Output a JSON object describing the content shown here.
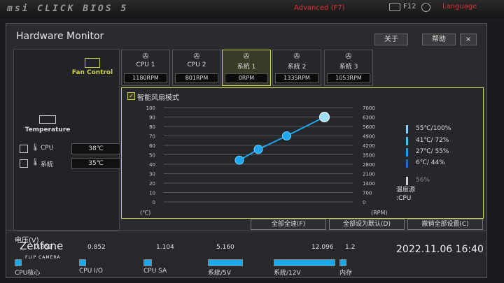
{
  "topbar": {
    "brand": "msi CLICK BIOS 5",
    "advanced": "Advanced (F7)",
    "f12": "F12",
    "language": "Language"
  },
  "window": {
    "title": "Hardware Monitor",
    "about": "关于",
    "help": "帮助",
    "close": "×"
  },
  "sidebar": {
    "fan_control": "Fan Control",
    "temperature": "Temperature",
    "sensors": [
      {
        "name": "CPU",
        "value": "38℃"
      },
      {
        "name": "系統",
        "value": "35℃"
      }
    ]
  },
  "fans": [
    {
      "name": "CPU 1",
      "rpm": "1180RPM",
      "active": false
    },
    {
      "name": "CPU 2",
      "rpm": "801RPM",
      "active": false
    },
    {
      "name": "系統 1",
      "rpm": "0RPM",
      "active": true
    },
    {
      "name": "系統 2",
      "rpm": "1335RPM",
      "active": false
    },
    {
      "name": "系統 3",
      "rpm": "1053RPM",
      "active": false
    }
  ],
  "smart_fan": {
    "label": "智能风扇模式"
  },
  "chart_data": {
    "type": "line",
    "x": [
      40,
      50,
      65,
      85
    ],
    "series": [
      {
        "values": [
          3100,
          3900,
          4900,
          6300
        ]
      }
    ],
    "xlabel": "(℃)",
    "ylabel": "(RPM)",
    "y_left_ticks": [
      "100",
      "90",
      "80",
      "70",
      "60",
      "50",
      "40",
      "30",
      "20",
      "10",
      "0"
    ],
    "y_right_ticks": [
      "7000",
      "6300",
      "5600",
      "4900",
      "4200",
      "3500",
      "2800",
      "2100",
      "1400",
      "700",
      "0"
    ],
    "grid": true
  },
  "legend": [
    {
      "text": "55℃/100%",
      "color": "#7fd3ff"
    },
    {
      "text": "41℃/ 72%",
      "color": "#47bdf5"
    },
    {
      "text": "27℃/ 55%",
      "color": "#1e9de0"
    },
    {
      "text": " 6℃/ 44%",
      "color": "#1673c4"
    },
    {
      "text": "56%",
      "color": "#cfcfcf"
    }
  ],
  "source": {
    "line1": "温度源",
    "line2": ":CPU"
  },
  "buttons": {
    "all_full": "全部全速(F)",
    "all_default": "全部设为默认(D)",
    "undo_all": "撤销全部设置(C)"
  },
  "voltage": {
    "title": "电压(V)",
    "values": [
      "0.852",
      "0.852",
      "1.104",
      "5.160",
      "12.096",
      "1.2"
    ],
    "fills": [
      0.1,
      0.1,
      0.12,
      0.6,
      0.95,
      0.1
    ],
    "labels": [
      "CPU核心",
      "CPU I/O",
      "CPU SA",
      "系統/5V",
      "系統/12V",
      "内存"
    ]
  },
  "overlay": {
    "zenfone": "Zenfone",
    "flip": "FLIP CAMERA",
    "timestamp": "2022.11.06 16:40"
  }
}
